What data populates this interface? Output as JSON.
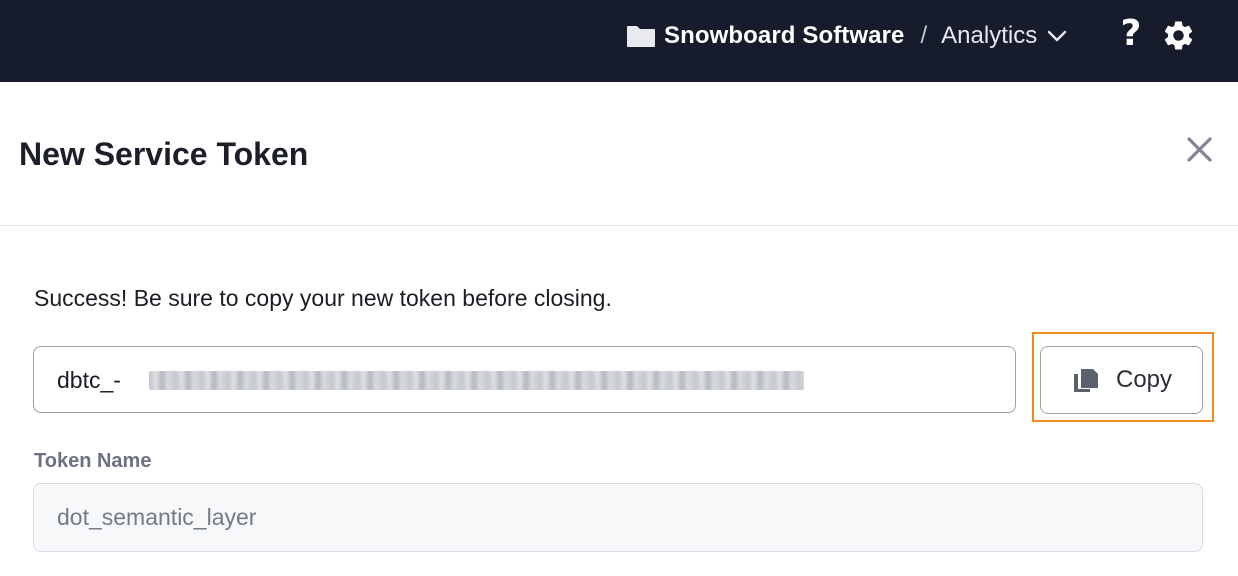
{
  "header": {
    "org_name": "Snowboard Software",
    "separator": "/",
    "project_name": "Analytics",
    "help_glyph": "?",
    "icons": [
      "folder-icon",
      "chevron-down-icon",
      "help-icon",
      "gear-icon"
    ]
  },
  "modal": {
    "title": "New Service Token",
    "close_icon": "close-icon",
    "success_message": "Success! Be sure to copy your new token before closing.",
    "token": {
      "visible_prefix": "dbtc_-",
      "redacted": true
    },
    "copy_button": {
      "label": "Copy",
      "icon": "copy-icon"
    },
    "token_name": {
      "label": "Token Name",
      "value": "dot_semantic_layer"
    }
  },
  "colors": {
    "topbar_bg": "#161c2b",
    "highlight": "#f08a1c"
  }
}
